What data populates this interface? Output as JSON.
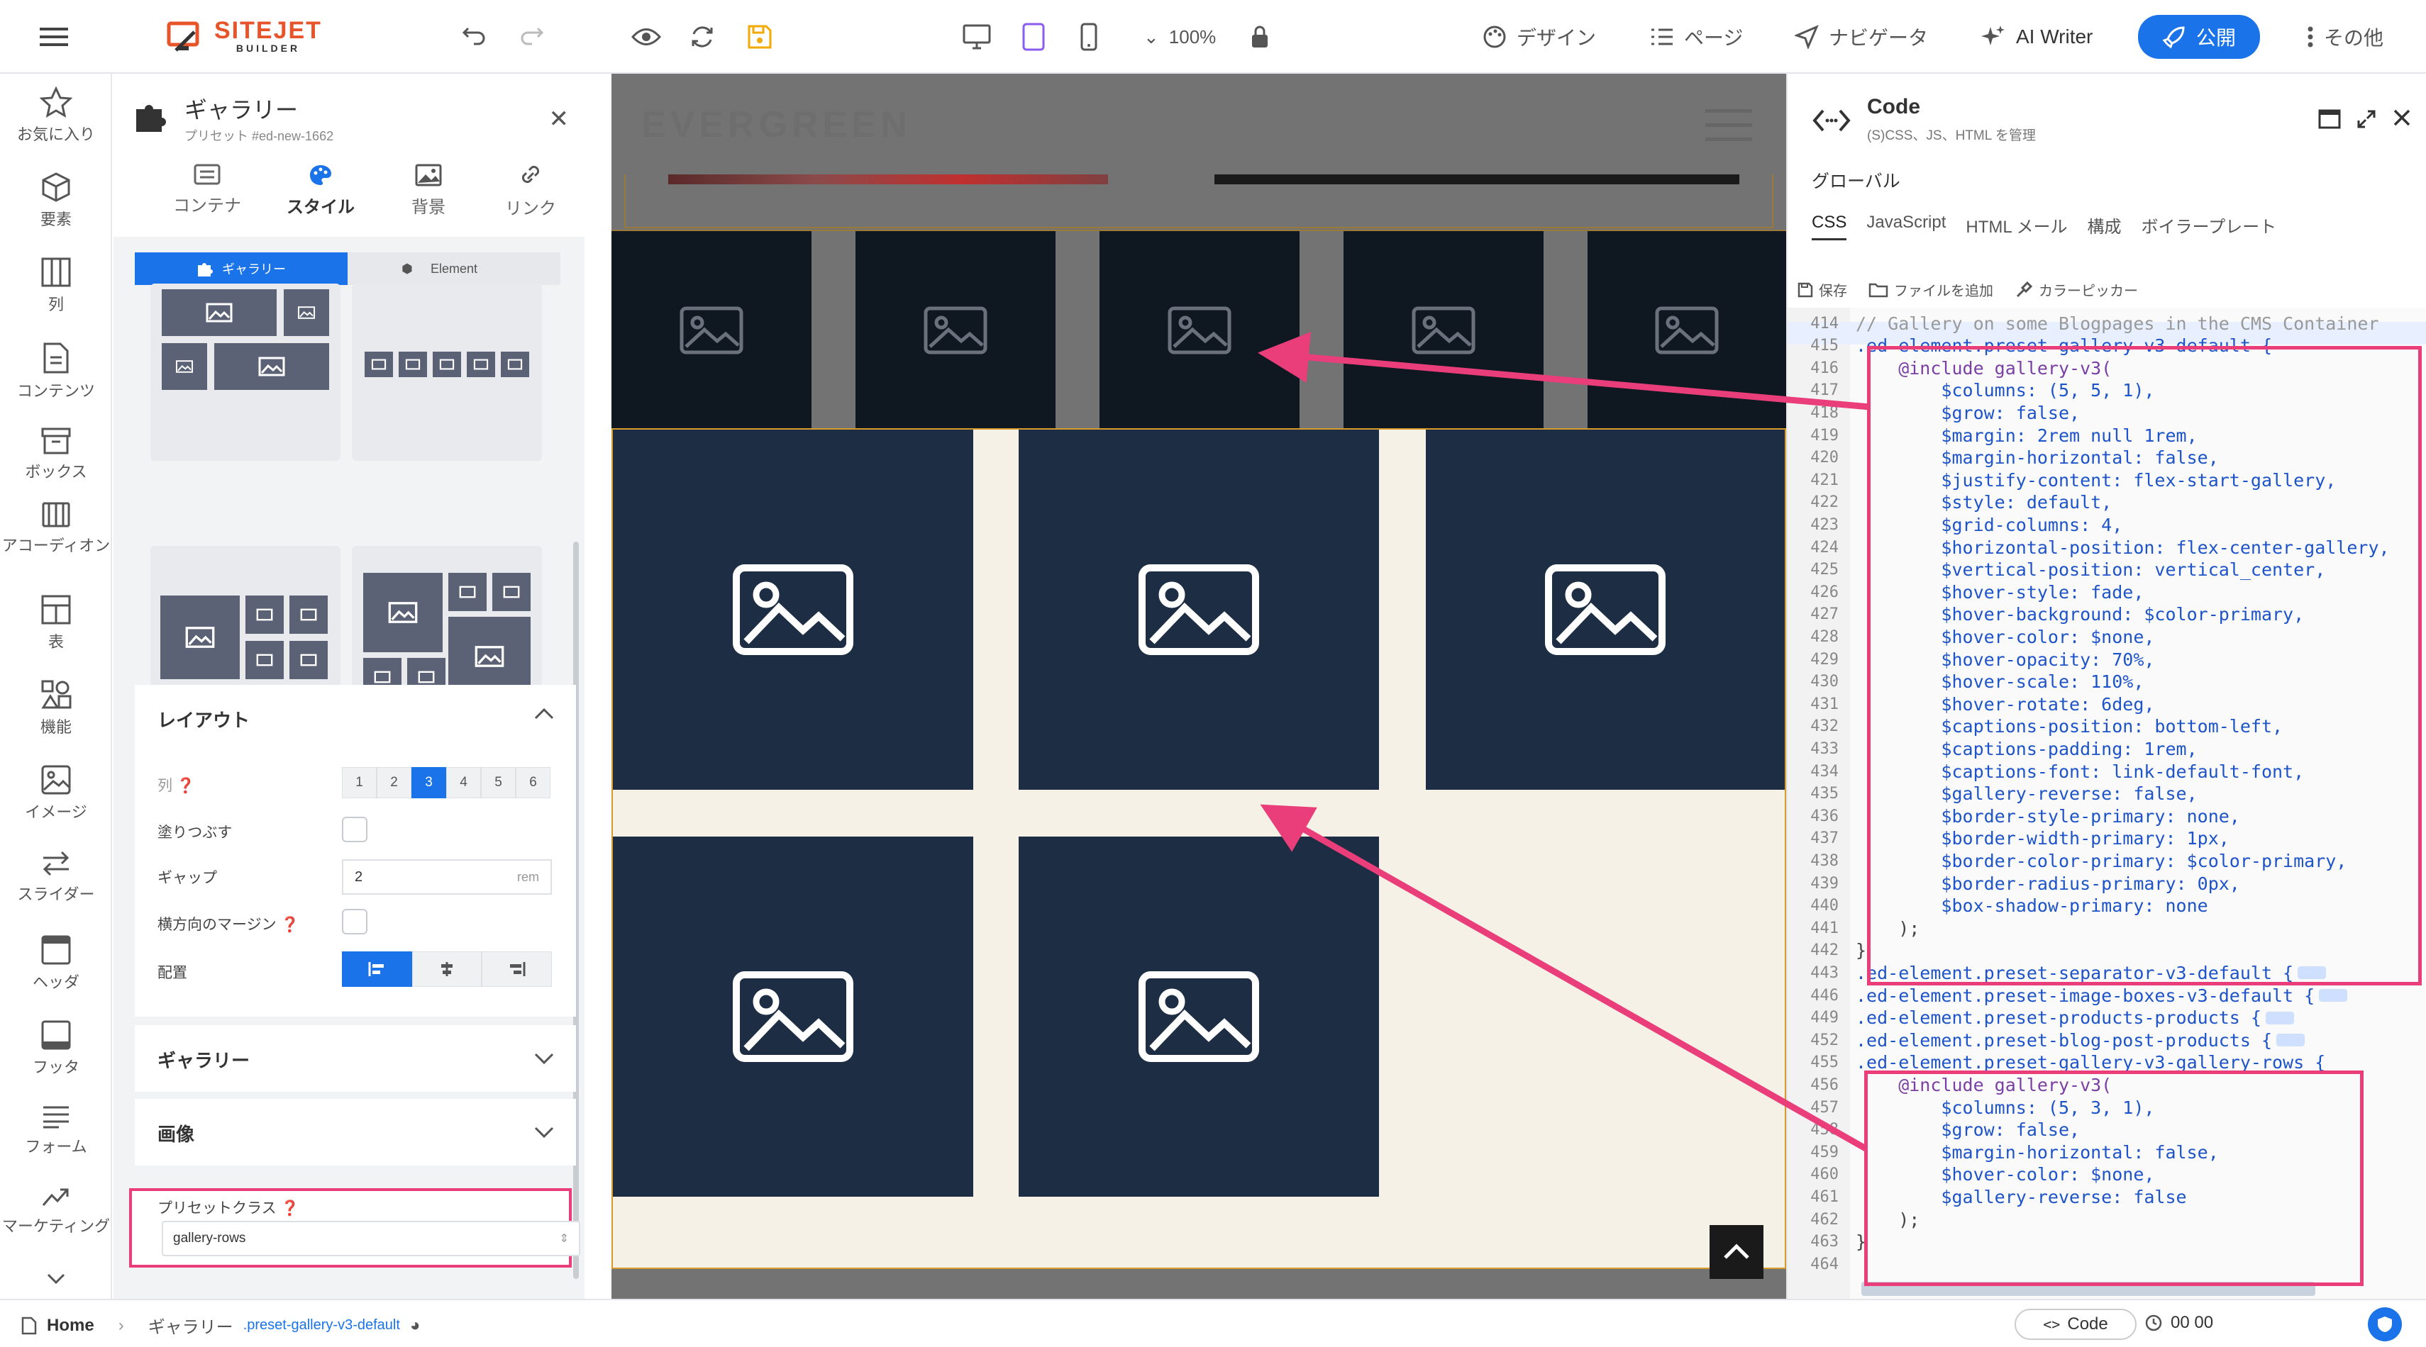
{
  "topbar": {
    "logo_name": "SITEJET",
    "logo_sub": "BUILDER",
    "zoom": "100%",
    "design": "デザイン",
    "pages": "ページ",
    "navigator": "ナビゲータ",
    "ai_writer": "AI Writer",
    "publish": "公開",
    "more": "その他"
  },
  "rail": {
    "items": [
      {
        "label": "お気に入り",
        "icon": "star-icon"
      },
      {
        "label": "要素",
        "icon": "cube-icon"
      },
      {
        "label": "列",
        "icon": "columns-icon"
      },
      {
        "label": "コンテンツ",
        "icon": "document-icon"
      },
      {
        "label": "ボックス",
        "icon": "box-icon"
      },
      {
        "label": "アコーディオン",
        "icon": "accordion-icon"
      },
      {
        "label": "表",
        "icon": "table-icon"
      },
      {
        "label": "機能",
        "icon": "shapes-icon"
      },
      {
        "label": "イメージ",
        "icon": "image-icon"
      },
      {
        "label": "スライダー",
        "icon": "slider-icon"
      },
      {
        "label": "ヘッダ",
        "icon": "header-icon"
      },
      {
        "label": "フッタ",
        "icon": "footer-icon"
      },
      {
        "label": "フォーム",
        "icon": "form-icon"
      },
      {
        "label": "マーケティング",
        "icon": "trend-icon"
      }
    ]
  },
  "panel": {
    "title": "ギャラリー",
    "subtitle": "プリセット #ed-new-1662",
    "tabs": [
      {
        "label": "コンテナ",
        "icon": "container-icon"
      },
      {
        "label": "スタイル",
        "icon": "palette-icon"
      },
      {
        "label": "背景",
        "icon": "image-icon"
      },
      {
        "label": "リンク",
        "icon": "link-icon"
      }
    ],
    "seg_gallery": "ギャラリー",
    "seg_element": "Element",
    "layout": {
      "title": "レイアウト",
      "columns_label": "列",
      "columns": [
        "1",
        "2",
        "3",
        "4",
        "5",
        "6"
      ],
      "columns_selected": "3",
      "fill_label": "塗りつぶす",
      "gap_label": "ギャップ",
      "gap_value": "2",
      "gap_unit": "rem",
      "hmargin_label": "横方向のマージン",
      "align_label": "配置"
    },
    "gallery_section": "ギャラリー",
    "image_section": "画像",
    "preset_label": "プリセットクラス",
    "preset_value": "gallery-rows"
  },
  "canvas": {
    "site_logo": "EVERGREEN"
  },
  "code": {
    "title": "Code",
    "subtitle": "(S)CSS、JS、HTML を管理",
    "global": "グローバル",
    "tabs": [
      "CSS",
      "JavaScript",
      "HTML メール",
      "構成",
      "ボイラープレート"
    ],
    "tools": [
      "保存",
      "ファイルを追加",
      "カラーピッカー"
    ],
    "lines": [
      {
        "n": "414",
        "t": "// Gallery on some Blogpages in the CMS Container"
      },
      {
        "n": "415",
        "t": ".ed-element.preset-gallery-v3-default {"
      },
      {
        "n": "416",
        "t": "    @include gallery-v3("
      },
      {
        "n": "417",
        "t": "        $columns: (5, 5, 1),"
      },
      {
        "n": "418",
        "t": "        $grow: false,"
      },
      {
        "n": "419",
        "t": "        $margin: 2rem null 1rem,"
      },
      {
        "n": "420",
        "t": "        $margin-horizontal: false,"
      },
      {
        "n": "421",
        "t": "        $justify-content: flex-start-gallery,"
      },
      {
        "n": "422",
        "t": "        $style: default,"
      },
      {
        "n": "423",
        "t": "        $grid-columns: 4,"
      },
      {
        "n": "424",
        "t": "        $horizontal-position: flex-center-gallery,"
      },
      {
        "n": "425",
        "t": "        $vertical-position: vertical_center,"
      },
      {
        "n": "426",
        "t": "        $hover-style: fade,"
      },
      {
        "n": "427",
        "t": "        $hover-background: $color-primary,"
      },
      {
        "n": "428",
        "t": "        $hover-color: $none,"
      },
      {
        "n": "429",
        "t": "        $hover-opacity: 70%,"
      },
      {
        "n": "430",
        "t": "        $hover-scale: 110%,"
      },
      {
        "n": "431",
        "t": "        $hover-rotate: 6deg,"
      },
      {
        "n": "432",
        "t": "        $captions-position: bottom-left,"
      },
      {
        "n": "433",
        "t": "        $captions-padding: 1rem,"
      },
      {
        "n": "434",
        "t": "        $captions-font: link-default-font,"
      },
      {
        "n": "435",
        "t": "        $gallery-reverse: false,"
      },
      {
        "n": "436",
        "t": "        $border-style-primary: none,"
      },
      {
        "n": "437",
        "t": "        $border-width-primary: 1px,"
      },
      {
        "n": "438",
        "t": "        $border-color-primary: $color-primary,"
      },
      {
        "n": "439",
        "t": "        $border-radius-primary: 0px,"
      },
      {
        "n": "440",
        "t": "        $box-shadow-primary: none"
      },
      {
        "n": "441",
        "t": "    );"
      },
      {
        "n": "442",
        "t": "}"
      },
      {
        "n": "443",
        "t": ".ed-element.preset-separator-v3-default {"
      },
      {
        "n": "446",
        "t": ".ed-element.preset-image-boxes-v3-default {"
      },
      {
        "n": "449",
        "t": ".ed-element.preset-products-products {"
      },
      {
        "n": "452",
        "t": ".ed-element.preset-blog-post-products {"
      },
      {
        "n": "455",
        "t": ".ed-element.preset-gallery-v3-gallery-rows {"
      },
      {
        "n": "456",
        "t": "    @include gallery-v3("
      },
      {
        "n": "457",
        "t": "        $columns: (5, 3, 1),"
      },
      {
        "n": "458",
        "t": "        $grow: false,"
      },
      {
        "n": "459",
        "t": "        $margin-horizontal: false,"
      },
      {
        "n": "460",
        "t": "        $hover-color: $none,"
      },
      {
        "n": "461",
        "t": "        $gallery-reverse: false"
      },
      {
        "n": "462",
        "t": "    );"
      },
      {
        "n": "463",
        "t": "}"
      },
      {
        "n": "464",
        "t": ""
      }
    ]
  },
  "statusbar": {
    "home": "Home",
    "crumb": "ギャラリー",
    "crumb_class": ".preset-gallery-v3-default",
    "time": "00 00",
    "code_btn": "Code"
  }
}
